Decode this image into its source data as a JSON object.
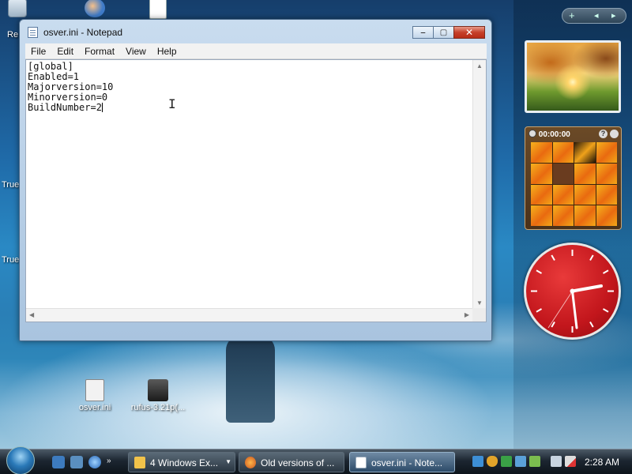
{
  "desktop": {
    "icons": [
      {
        "label": "osver.ini"
      },
      {
        "label": "rufus-3.21p(..."
      }
    ],
    "partial_labels": [
      "Re",
      "True",
      "True"
    ]
  },
  "notepad": {
    "title": "osver.ini - Notepad",
    "menu": [
      "File",
      "Edit",
      "Format",
      "View",
      "Help"
    ],
    "content": "[global]\nEnabled=1\nMajorversion=10\nMinorversion=0\nBuildNumber=2",
    "caption": {
      "minimize": "‒",
      "maximize": "▢",
      "close": "✕"
    }
  },
  "gadgets": {
    "sidebar_controls": {
      "add": "+",
      "prev": "◂",
      "next": "▸"
    },
    "puzzle_timer": "00:00:00",
    "puzzle_help": "?",
    "clock_time": "2:28"
  },
  "taskbar": {
    "tasks": [
      {
        "label": "4 Windows Ex...",
        "icon": "folder-icon",
        "dropdown": "▼"
      },
      {
        "label": "Old versions of ...",
        "icon": "firefox-icon"
      },
      {
        "label": "osver.ini - Note...",
        "icon": "notepad-icon",
        "active": true
      }
    ],
    "clock": "2:28 AM"
  },
  "colors": {
    "accent": "#2a79b8",
    "close_red": "#c6402a",
    "clock_red": "#c2161c",
    "puzzle_orange": "#e96a10"
  }
}
